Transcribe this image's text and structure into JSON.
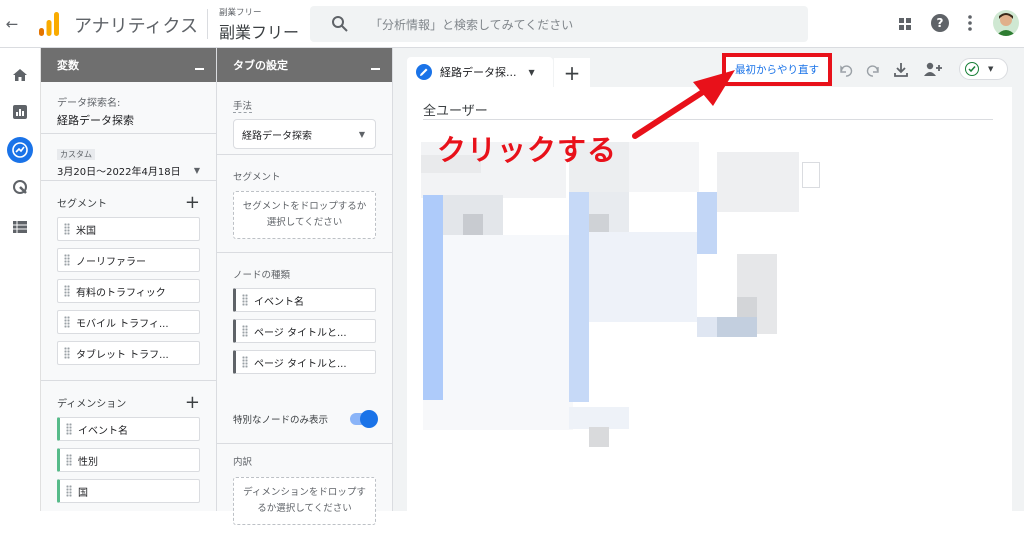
{
  "header": {
    "back_icon": "arrow-left-icon",
    "app_name": "アナリティクス",
    "account_small": "副業フリー",
    "property_name": "副業フリー",
    "search_placeholder": "「分析情報」と検索してみてください",
    "right_icons": [
      "apps-grid-icon",
      "help-icon",
      "more-vert-icon",
      "avatar"
    ]
  },
  "rail": {
    "items": [
      "home-icon",
      "reports-icon",
      "explore-icon",
      "advertising-icon",
      "configure-icon"
    ]
  },
  "variables_panel": {
    "title": "変数",
    "exploration_name_label": "データ探索名:",
    "exploration_name": "経路データ探索",
    "date_badge": "カスタム",
    "date_range": "3月20日〜2022年4月18日",
    "segments_label": "セグメント",
    "segments": [
      "米国",
      "ノーリファラー",
      "有料のトラフィック",
      "モバイル トラフィ...",
      "タブレット トラフ..."
    ],
    "dimensions_label": "ディメンション",
    "dimensions": [
      "イベント名",
      "性別",
      "国"
    ]
  },
  "tab_settings_panel": {
    "title": "タブの設定",
    "method_label": "手法",
    "method_value": "経路データ探索",
    "segment_label": "セグメント",
    "segment_drop": "セグメントをドロップするか選択してください",
    "node_type_label": "ノードの種類",
    "node_types": [
      "イベント名",
      "ページ タイトルと...",
      "ページ タイトルと..."
    ],
    "special_nodes_label": "特別なノードのみ表示",
    "special_nodes_on": true,
    "breakdown_label": "内訳",
    "breakdown_drop": "ディメンションをドロップするか選択してください"
  },
  "canvas": {
    "tab_label": "経路データ探...",
    "add_tab": "+",
    "start_over_button": "最初からやり直す",
    "annotation_text": "クリックする",
    "content_header": "全ユーザー",
    "toolbar_icons": [
      "undo-icon",
      "redo-icon",
      "download-icon",
      "share-icon",
      "check-circle-icon"
    ],
    "annotation_color": "#e8111a"
  }
}
